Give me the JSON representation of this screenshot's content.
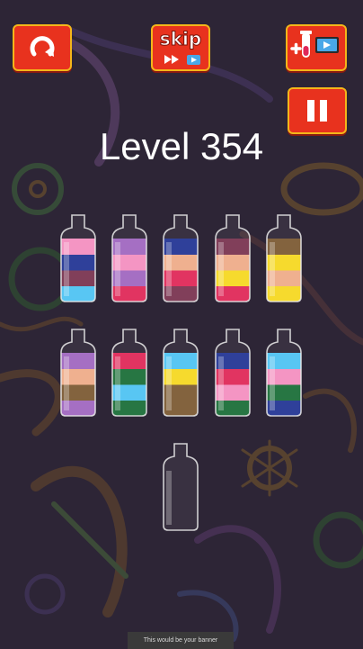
{
  "level": {
    "title": "Level 354"
  },
  "toolbar": {
    "skip_label": "skip",
    "accent": "#e8321e",
    "border": "#f3b61a"
  },
  "icons": {
    "restart": "restart-arrow-icon",
    "skip": "fast-forward-icon",
    "video": "video-ad-icon",
    "add_tube": "test-tube-plus-icon",
    "pause": "pause-icon"
  },
  "bottles": [
    {
      "layers_top_to_bottom": [
        "pink",
        "navy",
        "maroon",
        "sky"
      ]
    },
    {
      "layers_top_to_bottom": [
        "purple",
        "pink",
        "purple",
        "crimson"
      ]
    },
    {
      "layers_top_to_bottom": [
        "navy",
        "peach",
        "crimson",
        "maroon"
      ]
    },
    {
      "layers_top_to_bottom": [
        "maroon",
        "peach",
        "yellow",
        "crimson"
      ]
    },
    {
      "layers_top_to_bottom": [
        "brown",
        "yellow",
        "peach",
        "yellow"
      ]
    },
    {
      "layers_top_to_bottom": [
        "purple",
        "peach",
        "brown",
        "purple"
      ]
    },
    {
      "layers_top_to_bottom": [
        "crimson",
        "green",
        "sky",
        "green"
      ]
    },
    {
      "layers_top_to_bottom": [
        "sky",
        "yellow",
        "brown",
        "brown"
      ]
    },
    {
      "layers_top_to_bottom": [
        "navy",
        "crimson",
        "pink",
        "green"
      ]
    },
    {
      "layers_top_to_bottom": [
        "sky",
        "pink",
        "green",
        "navy"
      ]
    },
    {
      "layers_top_to_bottom": []
    }
  ],
  "colors": {
    "pink": "#f48fc0",
    "navy": "#223594",
    "maroon": "#7a3350",
    "sky": "#4ec3f3",
    "purple": "#a066c0",
    "crimson": "#e02858",
    "peach": "#eeac88",
    "yellow": "#f6d820",
    "brown": "#7c5a32",
    "green": "#1a6e38"
  },
  "banner": {
    "text": "This would be your banner"
  }
}
